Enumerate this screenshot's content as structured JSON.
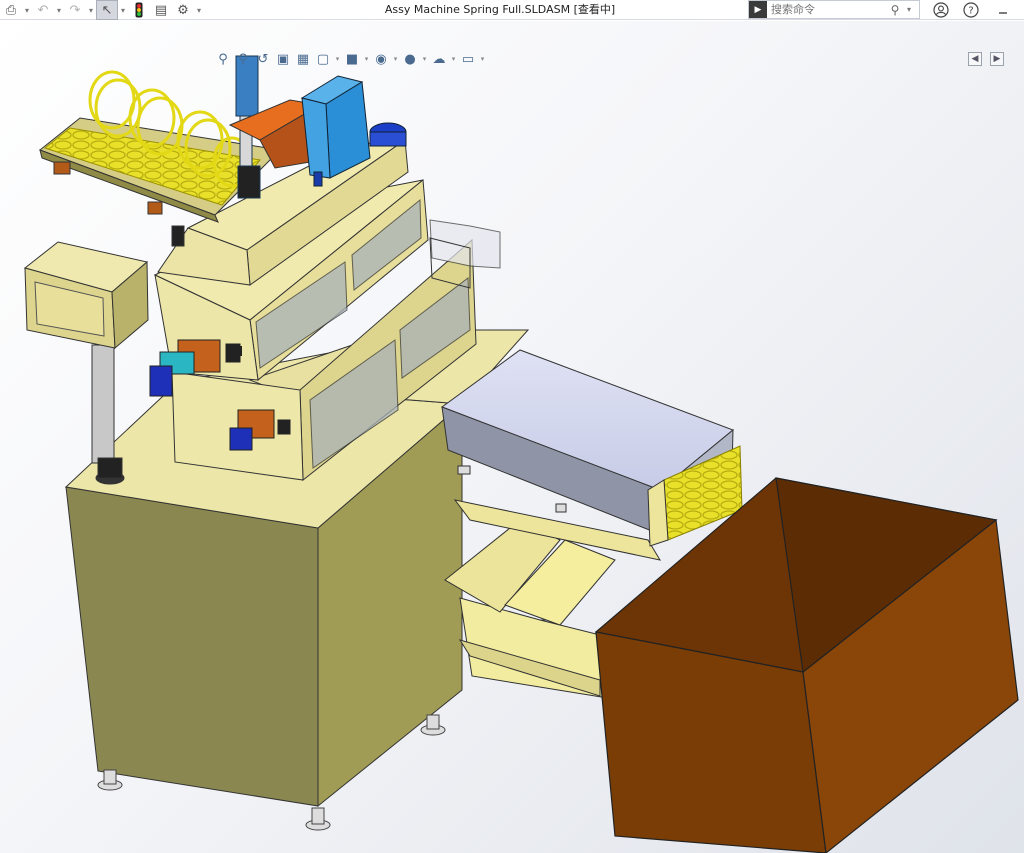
{
  "window": {
    "title": "Assy Machine Spring Full.SLDASM [查看中]"
  },
  "search": {
    "placeholder": "搜索命令",
    "value": ""
  },
  "toolbar_icons": [
    "print-icon",
    "undo-icon",
    "redo-icon",
    "select-pointer-icon",
    "rebuild-traffic-light-icon",
    "file-properties-icon",
    "options-gear-icon"
  ],
  "heads_up_icons": [
    "zoom-to-fit-icon",
    "zoom-to-area-icon",
    "previous-view-icon",
    "section-view-icon",
    "dynamic-annotation-view-icon",
    "view-orientation-icon",
    "display-style-icon",
    "hide-show-items-icon",
    "edit-appearance-icon",
    "apply-scene-icon",
    "view-settings-icon"
  ],
  "top_right_icons": [
    "account-user-icon",
    "help-question-icon",
    "minimize-window-icon"
  ],
  "colors": {
    "machine_body": "#EAE2A0",
    "machine_shadow": "#A29E52",
    "bin": "#7E3F06",
    "spring_coil": "#F2EB2C",
    "cylinder_blue": "#2F98DB",
    "tray_lavender": "#D4D8F0",
    "motor_blue": "#1E2FB8",
    "bracket_orange": "#D8661E"
  }
}
